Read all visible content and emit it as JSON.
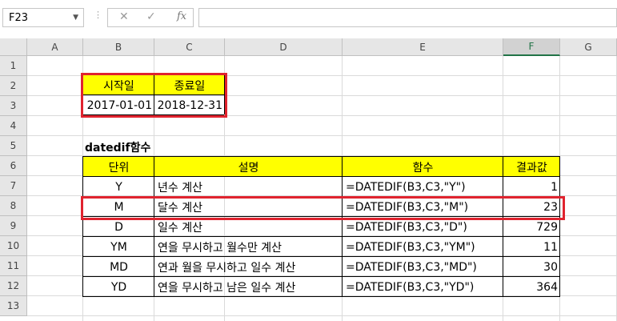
{
  "formula_bar": {
    "name_box": "F23",
    "name_box_dropdown_icon": "chevron-down-icon",
    "cancel_icon": "close-icon",
    "enter_icon": "check-icon",
    "fx_label": "fx",
    "formula": ""
  },
  "columns": [
    "A",
    "B",
    "C",
    "D",
    "E",
    "F",
    "G"
  ],
  "selected_column": "F",
  "rows": [
    "1",
    "2",
    "3",
    "4",
    "5",
    "6",
    "7",
    "8",
    "9",
    "10",
    "11",
    "12",
    "13"
  ],
  "date_header": {
    "start": "시작일",
    "end": "종료일"
  },
  "dates": {
    "start": "2017-01-01",
    "end": "2018-12-31"
  },
  "section_title": "datedif함수",
  "table": {
    "headers": {
      "unit": "단위",
      "desc": "설명",
      "func": "함수",
      "result": "결과값"
    },
    "rows": [
      {
        "unit": "Y",
        "desc": "년수 계산",
        "func": "=DATEDIF(B3,C3,\"Y\")",
        "result": "1"
      },
      {
        "unit": "M",
        "desc": "달수 계산",
        "func": "=DATEDIF(B3,C3,\"M\")",
        "result": "23"
      },
      {
        "unit": "D",
        "desc": "일수 계산",
        "func": "=DATEDIF(B3,C3,\"D\")",
        "result": "729"
      },
      {
        "unit": "YM",
        "desc": "연을 무시하고 월수만 계산",
        "func": "=DATEDIF(B3,C3,\"YM\")",
        "result": "11"
      },
      {
        "unit": "MD",
        "desc": "연과 월을 무시하고 일수 계산",
        "func": "=DATEDIF(B3,C3,\"MD\")",
        "result": "30"
      },
      {
        "unit": "YD",
        "desc": "연을 무시하고 남은 일수 계산",
        "func": "=DATEDIF(B3,C3,\"YD\")",
        "result": "364"
      }
    ]
  },
  "colors": {
    "highlight_fill": "#ffff00",
    "annotation_box": "#e0232e",
    "selection": "#217346"
  }
}
